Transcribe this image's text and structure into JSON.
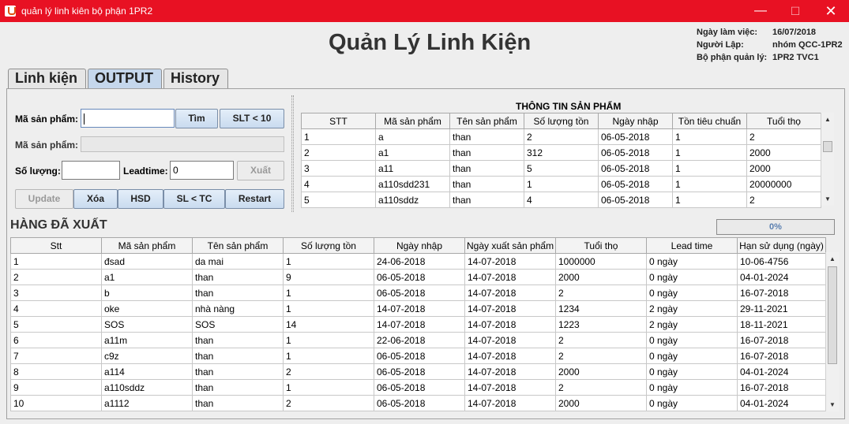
{
  "window": {
    "title": "quản lý linh kiên bộ phận 1PR2",
    "minimize": "—",
    "maximize": "☐",
    "close": "✕"
  },
  "header": {
    "title": "Quản Lý Linh Kiện",
    "work_date_label": "Ngày làm việc:",
    "work_date_value": "16/07/2018",
    "creator_label": "Người Lập:",
    "creator_value": "nhóm QCC-1PR2",
    "dept_label": "Bộ phận quản lý:",
    "dept_value": "1PR2 TVC1"
  },
  "tabs": [
    {
      "label": "Linh kiện"
    },
    {
      "label": "OUTPUT"
    },
    {
      "label": "History"
    }
  ],
  "form": {
    "ma_sp_label": "Mã sản phẩm:",
    "ma_sp_value": "",
    "tim_button": "Tìm",
    "slt_button": "SLT < 10",
    "ma_sp2_label": "Mã sản phẩm:",
    "ma_sp2_value": "",
    "so_luong_label": "Số lượng:",
    "so_luong_value": "",
    "leadtime_label": "Leadtime:",
    "leadtime_value": "0",
    "xuat_button": "Xuất",
    "update_button": "Update",
    "xoa_button": "Xóa",
    "hsd_button": "HSD",
    "sltc_button": "SL < TC",
    "restart_button": "Restart"
  },
  "product_info": {
    "title": "THÔNG TIN SẢN PHẨM",
    "columns": [
      "STT",
      "Mã sản phẩm",
      "Tên sản phẩm",
      "Số lượng tồn",
      "Ngày nhập",
      "Tồn tiêu chuẩn",
      "Tuổi thọ"
    ],
    "rows": [
      [
        "1",
        "a",
        "than",
        "2",
        "06-05-2018",
        "1",
        "2"
      ],
      [
        "2",
        "a1",
        "than",
        "312",
        "06-05-2018",
        "1",
        "2000"
      ],
      [
        "3",
        "a11",
        "than",
        "5",
        "06-05-2018",
        "1",
        "2000"
      ],
      [
        "4",
        "a110sdd231",
        "than",
        "1",
        "06-05-2018",
        "1",
        "20000000"
      ],
      [
        "5",
        "a110sddz",
        "than",
        "4",
        "06-05-2018",
        "1",
        "2"
      ]
    ]
  },
  "exported": {
    "title": "HÀNG ĐÃ XUẤT",
    "progress_text": "0%",
    "progress_value": 0,
    "columns": [
      "Stt",
      "Mã sản phẩm",
      "Tên sản phẩm",
      "Số lượng tồn",
      "Ngày nhập",
      "Ngày xuất sản phẩm",
      "Tuổi thọ",
      "Lead time",
      "Hạn sử dụng (ngày)"
    ],
    "rows": [
      [
        "1",
        "đsad",
        "da mai",
        "1",
        "24-06-2018",
        "14-07-2018",
        "1000000",
        "0 ngày",
        "10-06-4756"
      ],
      [
        "2",
        "a1",
        "than",
        "9",
        "06-05-2018",
        "14-07-2018",
        "2000",
        "0 ngày",
        "04-01-2024"
      ],
      [
        "3",
        "b",
        "than",
        "1",
        "06-05-2018",
        "14-07-2018",
        "2",
        "0 ngày",
        "16-07-2018"
      ],
      [
        "4",
        "oke",
        "nhà nàng",
        "1",
        "14-07-2018",
        "14-07-2018",
        "1234",
        "2 ngày",
        "29-11-2021"
      ],
      [
        "5",
        "SOS",
        "SOS",
        "14",
        "14-07-2018",
        "14-07-2018",
        "1223",
        "2 ngày",
        "18-11-2021"
      ],
      [
        "6",
        "a11m",
        "than",
        "1",
        "22-06-2018",
        "14-07-2018",
        "2",
        "0 ngày",
        "16-07-2018"
      ],
      [
        "7",
        "c9z",
        "than",
        "1",
        "06-05-2018",
        "14-07-2018",
        "2",
        "0 ngày",
        "16-07-2018"
      ],
      [
        "8",
        "a114",
        "than",
        "2",
        "06-05-2018",
        "14-07-2018",
        "2000",
        "0 ngày",
        "04-01-2024"
      ],
      [
        "9",
        "a110sddz",
        "than",
        "1",
        "06-05-2018",
        "14-07-2018",
        "2",
        "0 ngày",
        "16-07-2018"
      ],
      [
        "10",
        "a1112",
        "than",
        "2",
        "06-05-2018",
        "14-07-2018",
        "2000",
        "0 ngày",
        "04-01-2024"
      ]
    ]
  }
}
